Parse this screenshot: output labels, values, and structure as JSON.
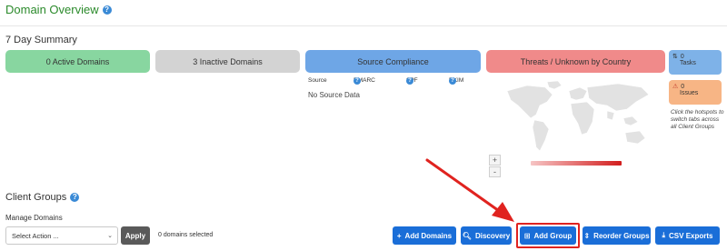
{
  "header": {
    "title": "Domain Overview",
    "help_icon": "question-circle-icon"
  },
  "summary": {
    "title": "7 Day Summary",
    "tiles": {
      "active": "0 Active Domains",
      "inactive": "3 Inactive Domains",
      "compliance": "Source Compliance",
      "threats": "Threats / Unknown by Country"
    },
    "compliance_headers": {
      "source": "Source",
      "dmarc": "DMARC",
      "spf": "SPF",
      "dkim": "DKIM"
    },
    "no_data": "No Source Data",
    "map": {
      "zoom_in": "+",
      "zoom_out": "-"
    },
    "side": {
      "tasks_count": "0",
      "tasks_label": "Tasks",
      "issues_count": "0",
      "issues_label": "Issues",
      "hint": "Click the hotspots to switch tabs across all Client Groups"
    }
  },
  "client_groups": {
    "title": "Client Groups",
    "manage_label": "Manage Domains",
    "select_value": "Select Action ...",
    "apply_label": "Apply",
    "selected_count": "0 domains selected",
    "buttons": {
      "add_domains": "Add Domains",
      "discovery": "Discovery",
      "add_group": "Add Group",
      "reorder_groups": "Reorder Groups",
      "csv_exports": "CSV Exports"
    }
  },
  "colors": {
    "active_tile": "#88d6a0",
    "inactive_tile": "#d3d3d3",
    "compliance_tile": "#6ea6e6",
    "threats_tile": "#f08a8a",
    "primary_button": "#1a6ed8",
    "highlight": "#e0231f"
  }
}
